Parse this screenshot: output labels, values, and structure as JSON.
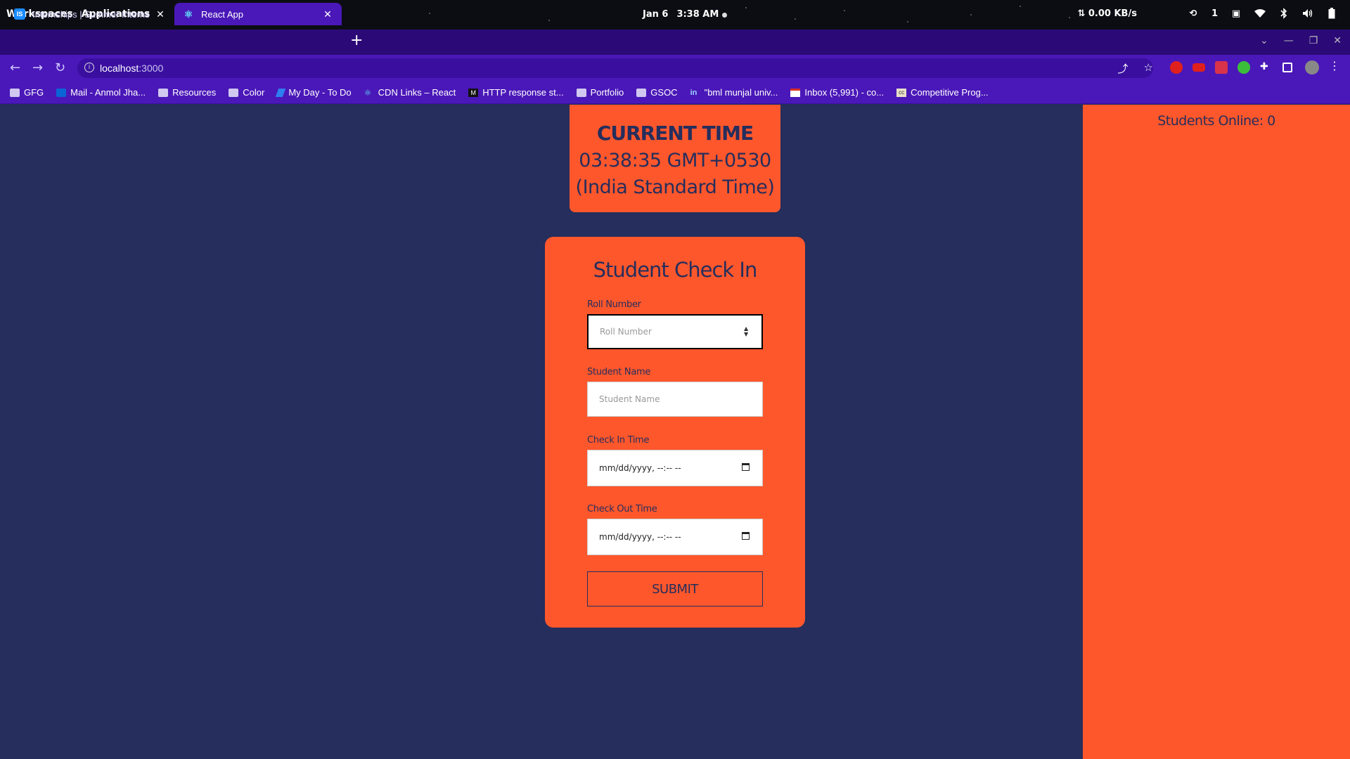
{
  "os_bar": {
    "workspaces": "Workspaces",
    "applications": "Applications",
    "date": "Jan 6",
    "time": "3:38 AM",
    "network_speed": "⇅ 0.00 KB/s",
    "workspace_number": "1",
    "icons": [
      "update-icon",
      "screen-icon",
      "wifi-icon",
      "bluetooth-icon",
      "volume-icon",
      "battery-icon"
    ]
  },
  "tabs": [
    {
      "title": "Internships | Summer Interns",
      "favicon": "IS",
      "favicon_color": "#1a8cff"
    },
    {
      "title": "React App",
      "favicon": "⚛",
      "favicon_color": "#2b0a78"
    }
  ],
  "address_bar": {
    "host": "localhost",
    "port": ":3000"
  },
  "bookmarks": [
    {
      "label": "GFG",
      "icon": "folder-icon"
    },
    {
      "label": "Mail - Anmol Jha...",
      "icon": "outlook-icon"
    },
    {
      "label": "Resources",
      "icon": "folder-icon"
    },
    {
      "label": "Color",
      "icon": "folder-icon"
    },
    {
      "label": "My Day - To Do",
      "icon": "todo-icon"
    },
    {
      "label": "CDN Links – React",
      "icon": "react-icon"
    },
    {
      "label": "HTTP response st...",
      "icon": "mdn-icon"
    },
    {
      "label": "Portfolio",
      "icon": "folder-icon"
    },
    {
      "label": "GSOC",
      "icon": "folder-icon"
    },
    {
      "label": "\"bml munjal univ...",
      "icon": "linkedin-icon"
    },
    {
      "label": "Inbox (5,991) - co...",
      "icon": "gmail-icon"
    },
    {
      "label": "Competitive Prog...",
      "icon": "cc-icon"
    }
  ],
  "colors": {
    "accent": "#ff572c",
    "page_bg": "#252e5c",
    "browser_accent": "#4a18b8"
  },
  "sidebar": {
    "students_online": "Students Online: 0"
  },
  "clock": {
    "title": "CURRENT TIME",
    "line1": "03:38:35 GMT+0530",
    "line2": "(India Standard Time)"
  },
  "form": {
    "title": "Student Check In",
    "roll_label": "Roll Number",
    "roll_placeholder": "Roll Number",
    "name_label": "Student Name",
    "name_placeholder": "Student Name",
    "checkin_label": "Check In Time",
    "checkin_value": "mm/dd/yyyy, --:-- --",
    "checkout_label": "Check Out Time",
    "checkout_value": "mm/dd/yyyy, --:-- --",
    "submit_label": "SUBMIT"
  }
}
